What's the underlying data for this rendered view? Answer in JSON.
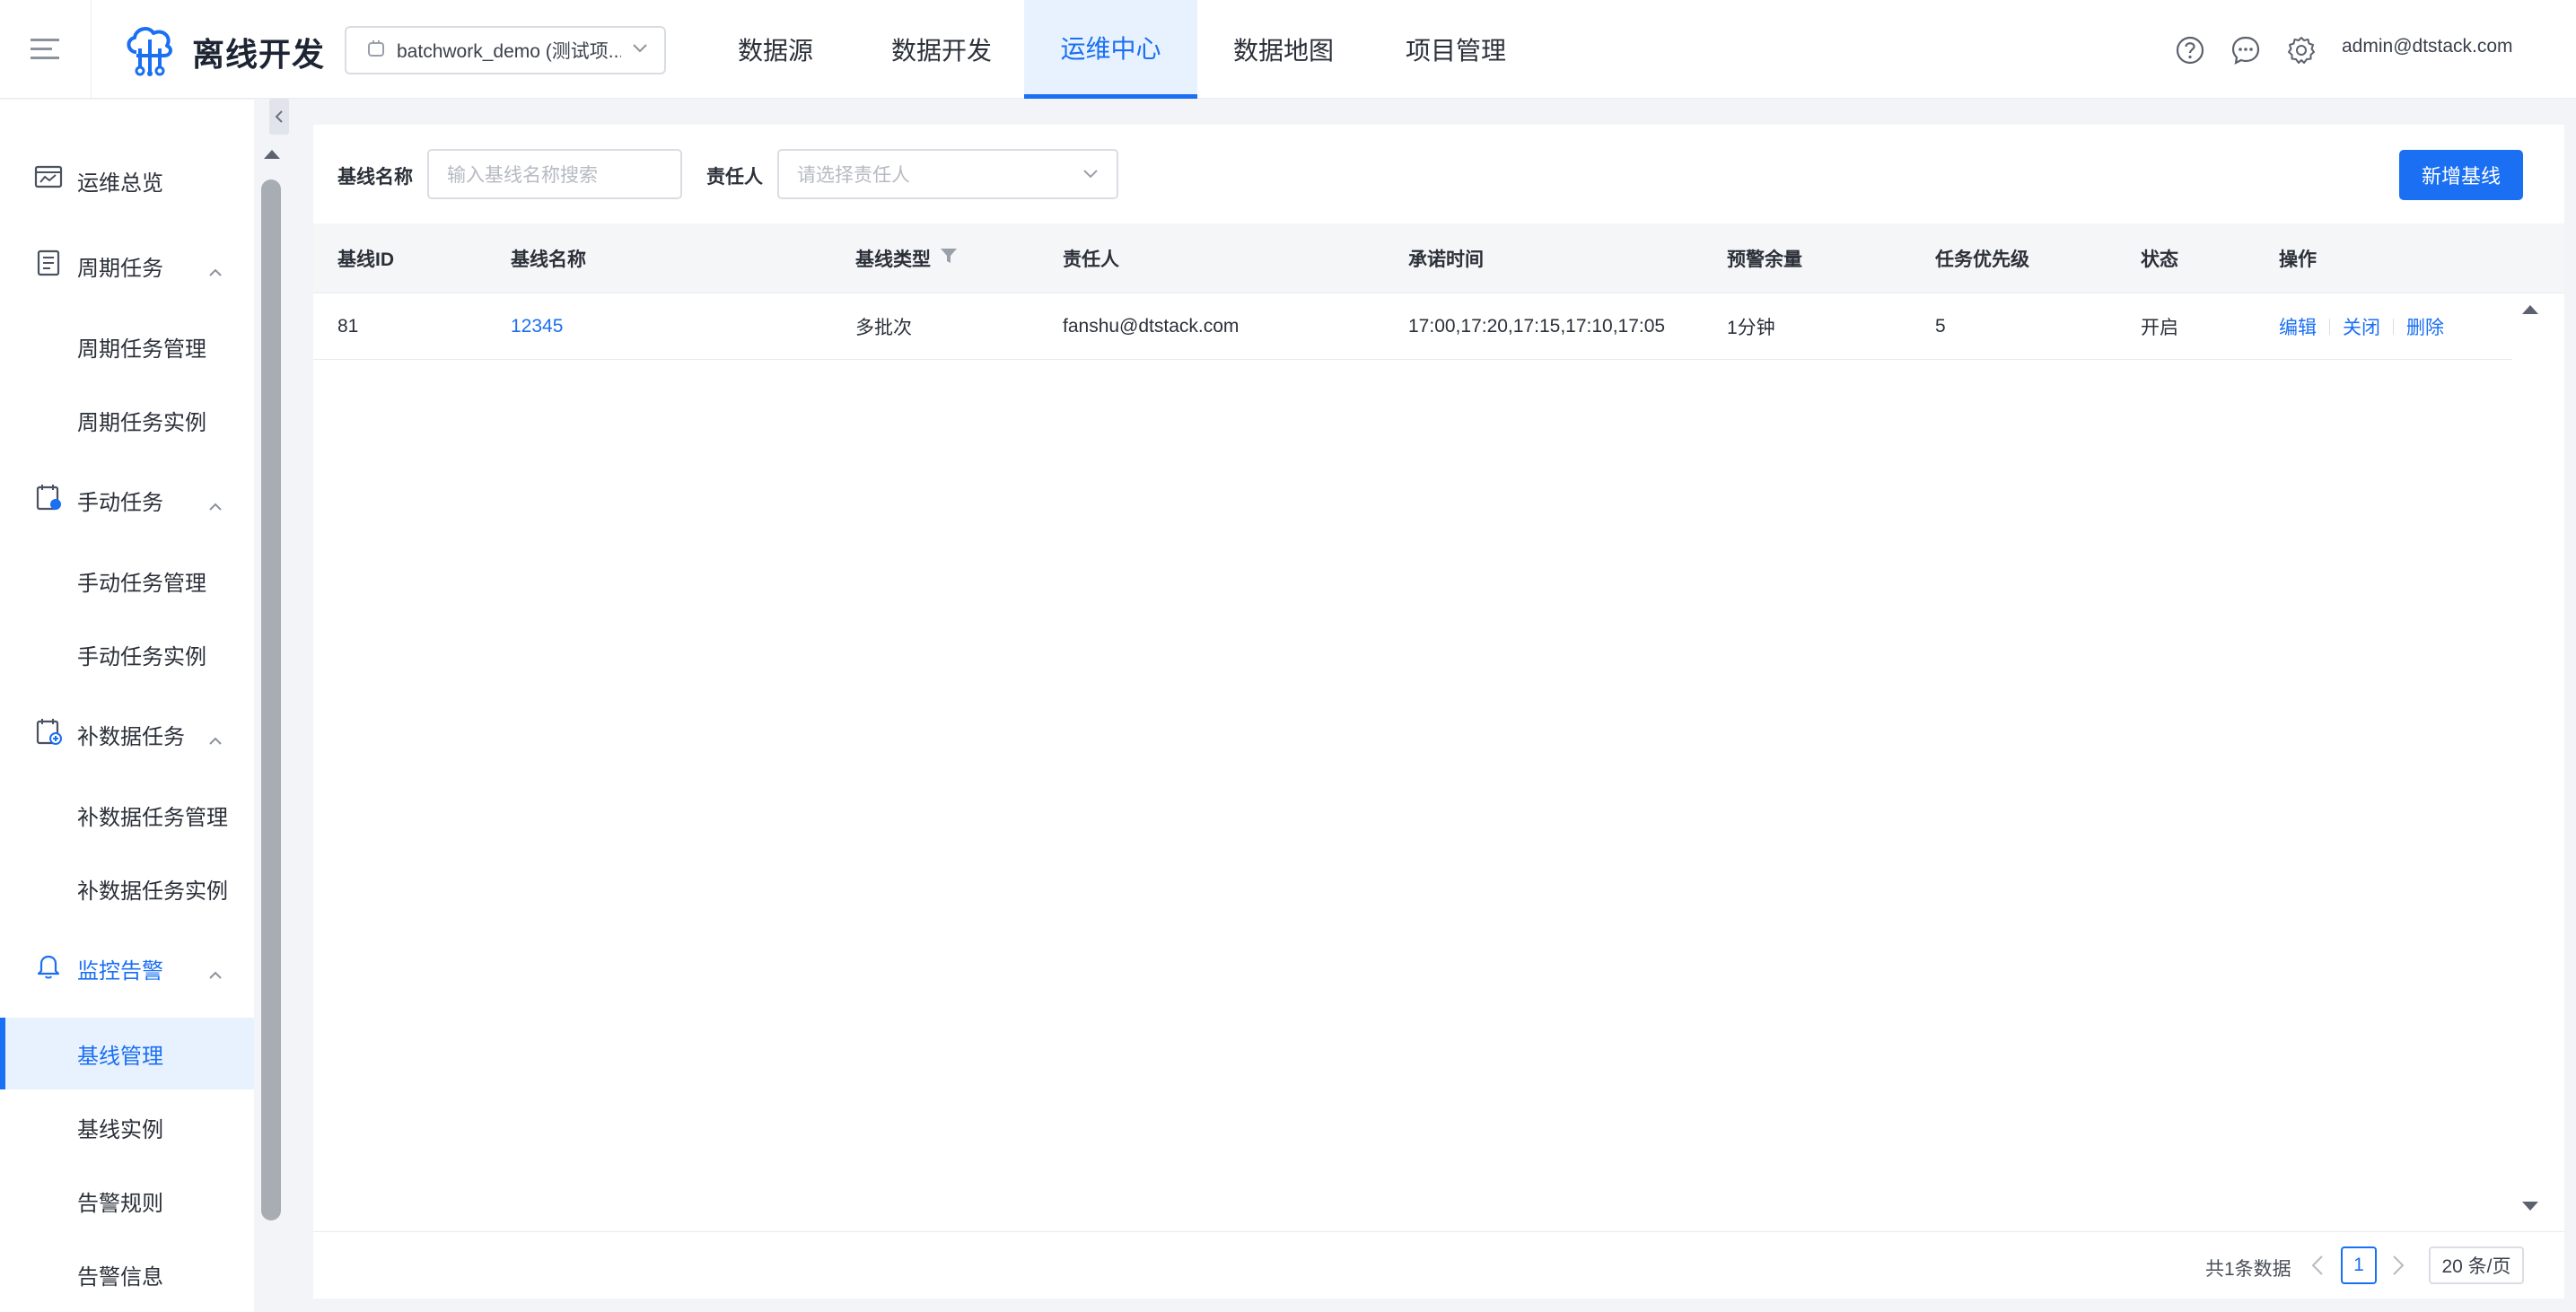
{
  "header": {
    "app_title": "离线开发",
    "project_select": "batchwork_demo (测试项...",
    "tabs": [
      {
        "label": "数据源"
      },
      {
        "label": "数据开发"
      },
      {
        "label": "运维中心",
        "active": true
      },
      {
        "label": "数据地图"
      },
      {
        "label": "项目管理"
      }
    ],
    "user": "admin@dtstack.com",
    "icons": [
      "help-icon",
      "message-icon",
      "settings-icon"
    ]
  },
  "sidebar": {
    "overview": "运维总览",
    "groups": [
      {
        "label": "周期任务",
        "items": [
          "周期任务管理",
          "周期任务实例"
        ]
      },
      {
        "label": "手动任务",
        "items": [
          "手动任务管理",
          "手动任务实例"
        ]
      },
      {
        "label": "补数据任务",
        "items": [
          "补数据任务管理",
          "补数据任务实例"
        ]
      },
      {
        "label": "监控告警",
        "items": [
          "基线管理",
          "基线实例",
          "告警规则",
          "告警信息"
        ]
      }
    ],
    "active_item": "基线管理"
  },
  "filters": {
    "name_label": "基线名称",
    "name_placeholder": "输入基线名称搜索",
    "owner_label": "责任人",
    "owner_placeholder": "请选择责任人",
    "add_button": "新增基线"
  },
  "table": {
    "columns": [
      "基线ID",
      "基线名称",
      "基线类型",
      "责任人",
      "承诺时间",
      "预警余量",
      "任务优先级",
      "状态",
      "操作"
    ],
    "rows": [
      {
        "id": "81",
        "name": "12345",
        "type": "多批次",
        "owner": "fanshu@dtstack.com",
        "commit_time": "17:00,17:20,17:15,17:10,17:05",
        "margin": "1分钟",
        "priority": "5",
        "status": "开启",
        "ops": [
          "编辑",
          "关闭",
          "删除"
        ]
      }
    ]
  },
  "pagination": {
    "total": "共1条数据",
    "current_page": "1",
    "page_size": "20 条/页"
  },
  "colors": {
    "accent": "#1a6ff2",
    "active_bg": "#e8f2ff",
    "page_bg": "#f2f4f8"
  }
}
